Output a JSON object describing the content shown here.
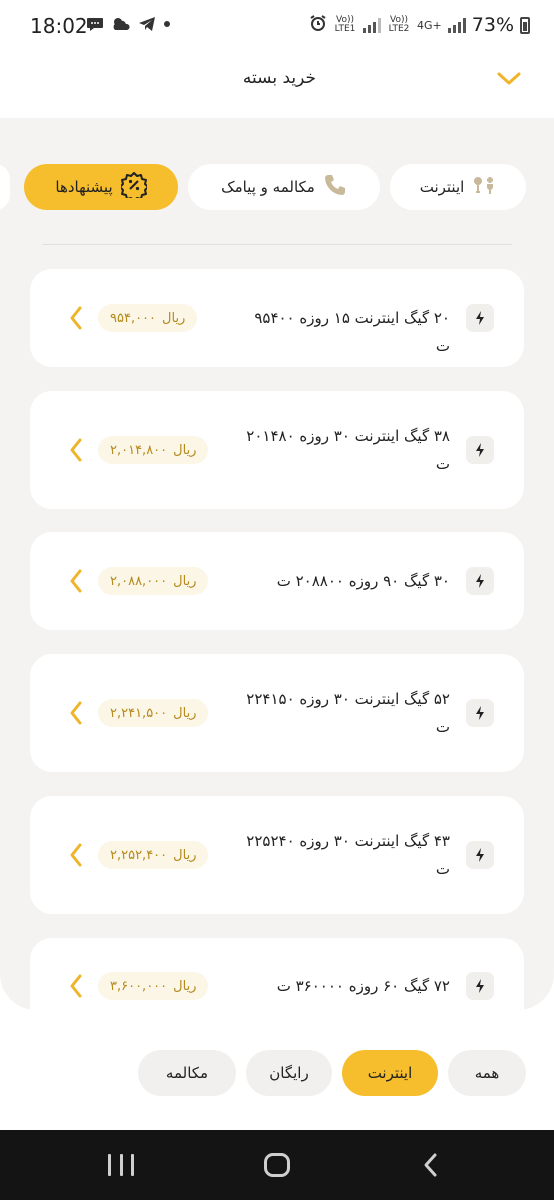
{
  "status_bar": {
    "time": "18:02",
    "left_icons": [
      "chat-icon",
      "weather-icon",
      "telegram-icon",
      "dot-icon"
    ],
    "sim1_label": "Vo)) LTE1",
    "sim2_label": "Vo)) LTE2",
    "network_type": "4G+",
    "battery": "73%"
  },
  "header": {
    "title": "خرید بسته",
    "collapse_icon": "chevron-down-icon"
  },
  "categories": [
    {
      "label": "اینترنت",
      "icon": "internet-icon",
      "active": false
    },
    {
      "label": "مکالمه و پیامک",
      "icon": "phone-icon",
      "active": false
    },
    {
      "label": "پیشنهادها",
      "icon": "discount-badge-icon",
      "active": true
    }
  ],
  "packages": [
    {
      "title": "۲۰ گیگ اینترنت ۱۵ روزه ۹۵۴۰۰ ت",
      "price": "۹۵۴,۰۰۰",
      "currency": "ریال"
    },
    {
      "title": "۳۸ گیگ اینترنت ۳۰ روزه ۲۰۱۴۸۰ ت",
      "price": "۲,۰۱۴,۸۰۰",
      "currency": "ریال"
    },
    {
      "title": "۳۰ گیگ ۹۰ روزه ۲۰۸۸۰۰ ت",
      "price": "۲,۰۸۸,۰۰۰",
      "currency": "ریال"
    },
    {
      "title": "۵۲ گیگ اینترنت ۳۰ روزه ۲۲۴۱۵۰ ت",
      "price": "۲,۲۴۱,۵۰۰",
      "currency": "ریال"
    },
    {
      "title": "۴۳ گیگ اینترنت ۳۰ روزه ۲۲۵۲۴۰ ت",
      "price": "۲,۲۵۲,۴۰۰",
      "currency": "ریال"
    },
    {
      "title": "۷۲ گیگ ۶۰ روزه ۳۶۰۰۰۰ ت",
      "price": "۳,۶۰۰,۰۰۰",
      "currency": "ریال"
    }
  ],
  "filters": [
    {
      "label": "همه",
      "active": false
    },
    {
      "label": "اینترنت",
      "active": true
    },
    {
      "label": "رایگان",
      "active": false
    },
    {
      "label": "مکالمه",
      "active": false
    }
  ],
  "colors": {
    "accent": "#f6bd2c",
    "background": "#f4f3f1",
    "price_text": "#b58a1e",
    "nav_bar": "#141414"
  }
}
